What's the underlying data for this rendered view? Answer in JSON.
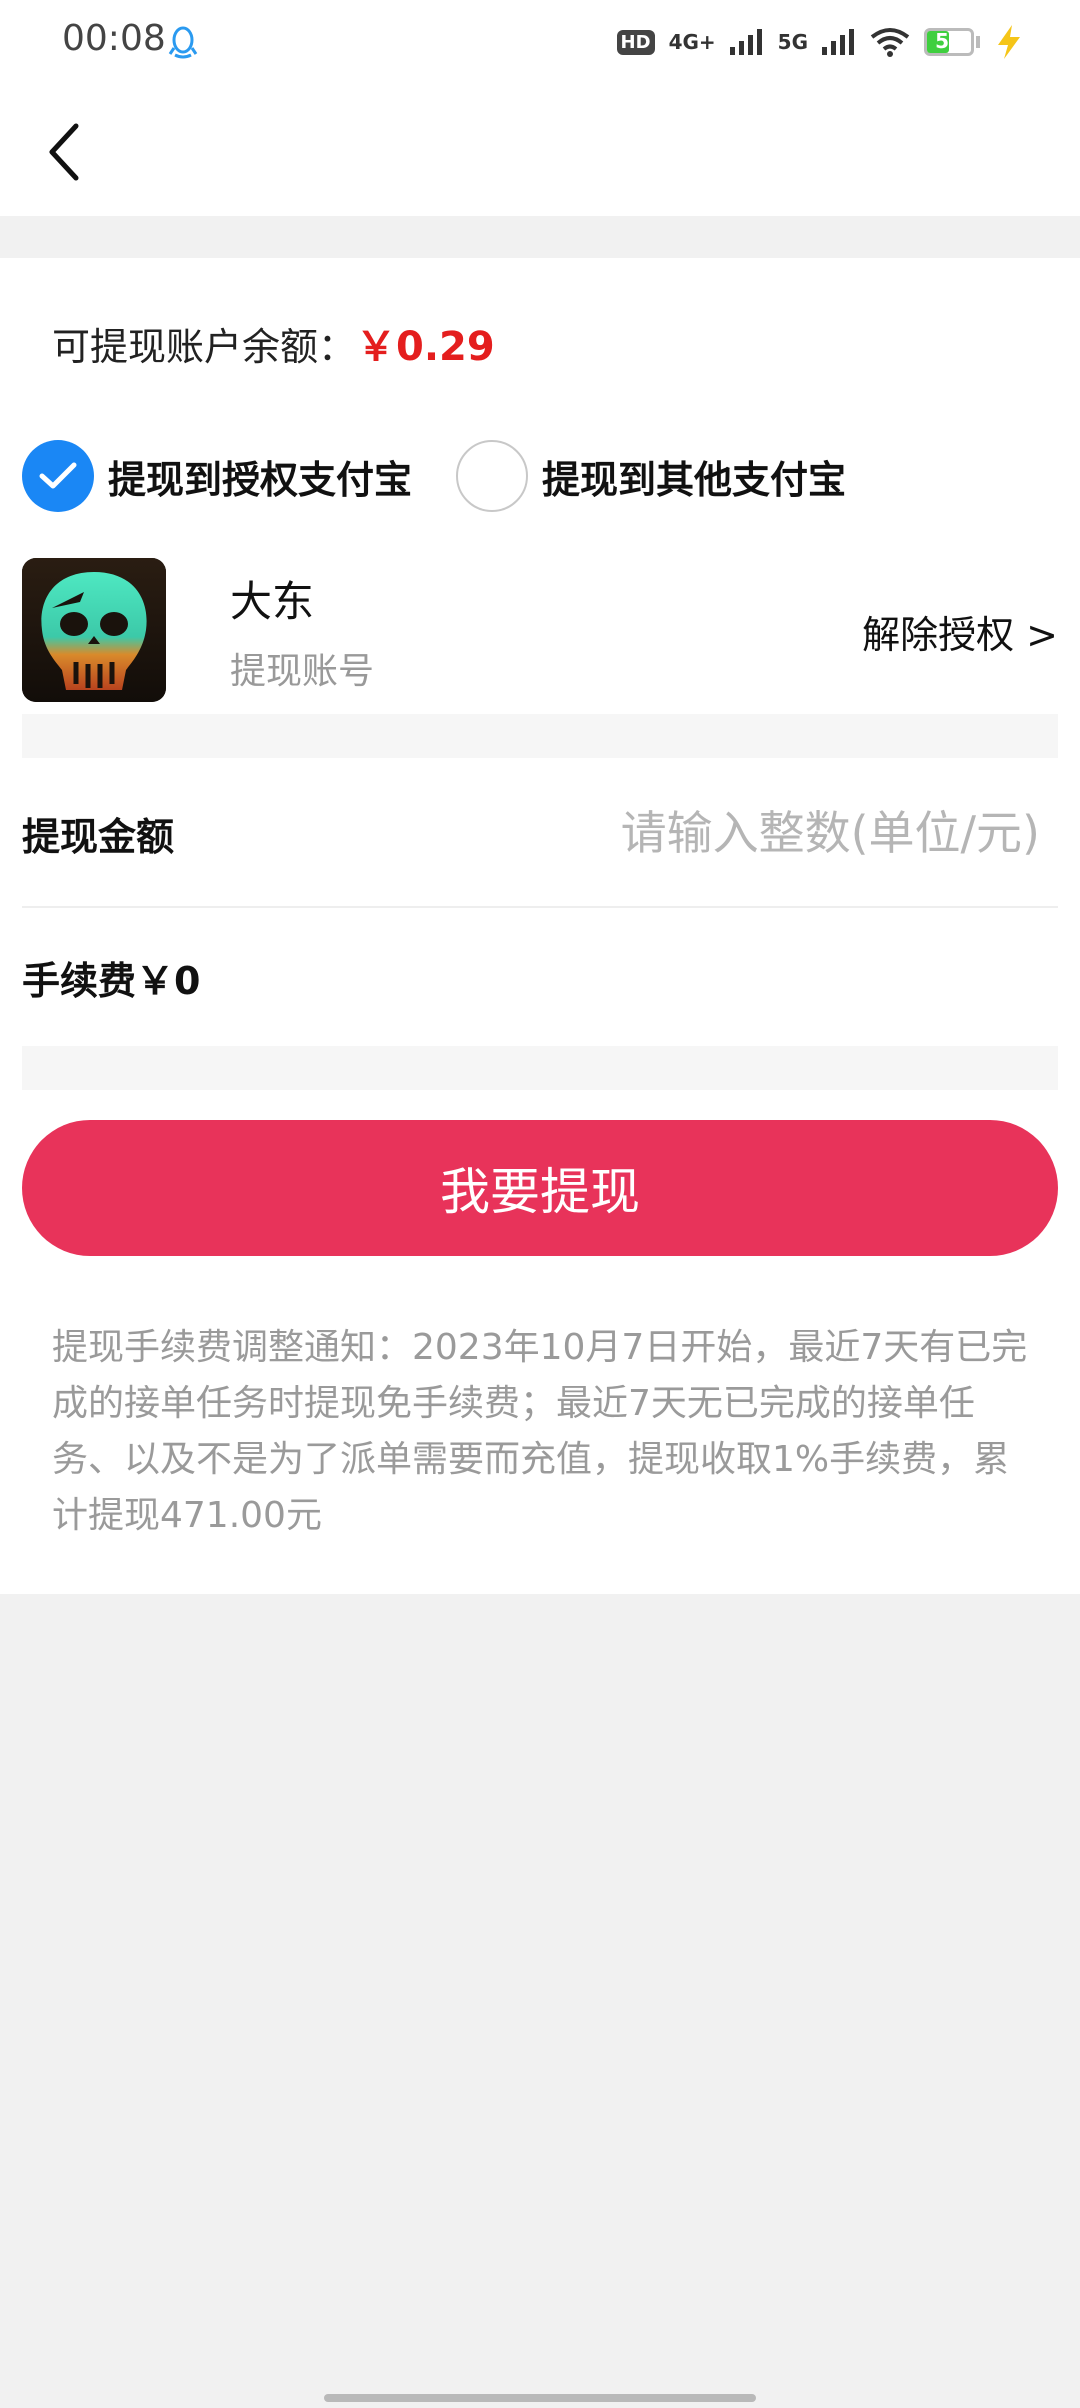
{
  "status_bar": {
    "time": "00:08",
    "hd_label": "HD",
    "network_1": "4G+",
    "network_2": "5G",
    "battery_level": "51",
    "battery_fraction": 0.51
  },
  "balance": {
    "label": "可提现账户余额：",
    "amount": "￥0.29"
  },
  "methods": [
    {
      "label": "提现到授权支付宝",
      "checked": true
    },
    {
      "label": "提现到其他支付宝",
      "checked": false
    }
  ],
  "account": {
    "name": "大东",
    "subtitle": "提现账号",
    "unbind_label": "解除授权 >"
  },
  "amount_field": {
    "label": "提现金额",
    "value": "",
    "placeholder": "请输入整数(单位/元)"
  },
  "fee": {
    "label": "手续费￥0"
  },
  "submit": {
    "label": "我要提现"
  },
  "notice": {
    "text": "提现手续费调整通知：2023年10月7日开始，最近7天有已完成的接单任务时提现免手续费；最近7天无已完成的接单任务、以及不是为了派单需要而充值，提现收取1%手续费，累计提现471.00元"
  },
  "colors": {
    "accent_blue": "#1a87f5",
    "balance_red": "#e41e1e",
    "button_pink": "#e8335a",
    "background_gray": "#f1f1f1"
  },
  "icons": {
    "back": "chevron-left-icon",
    "notification": "qq-penguin-icon",
    "check": "check-icon",
    "wifi": "wifi-icon",
    "signal": "signal-icon",
    "charging": "lightning-icon"
  }
}
